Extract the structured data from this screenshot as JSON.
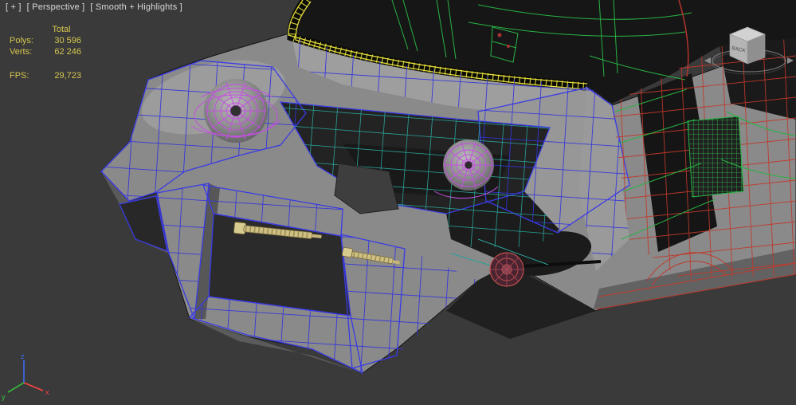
{
  "viewport": {
    "label_plus": "[ + ]",
    "label_view": "[ Perspective ]",
    "label_shading": "[ Smooth + Highlights ]"
  },
  "stats": {
    "total_label": "Total",
    "polys_label": "Polys:",
    "polys_value": "30 596",
    "verts_label": "Verts:",
    "verts_value": "62 246",
    "fps_label": "FPS:",
    "fps_value": "29,723"
  },
  "viewcube": {
    "back_face_label": "BACK"
  },
  "axis_tripod": {
    "x_label": "x",
    "y_label": "y",
    "z_label": "z"
  },
  "colors": {
    "viewport_bg": "#3a3a3a",
    "stats_text": "#d4c54f",
    "viewport_label_text": "#d8d8d8",
    "wire_blue": "#3434de",
    "wire_purple": "#c44fe2",
    "wire_teal": "#2aa198",
    "wire_green": "#28b344",
    "wire_red": "#c0392b",
    "wire_yellow": "#e6df3e",
    "shaft_tan": "#cfc083",
    "body_gray": "#8a8a8a"
  }
}
